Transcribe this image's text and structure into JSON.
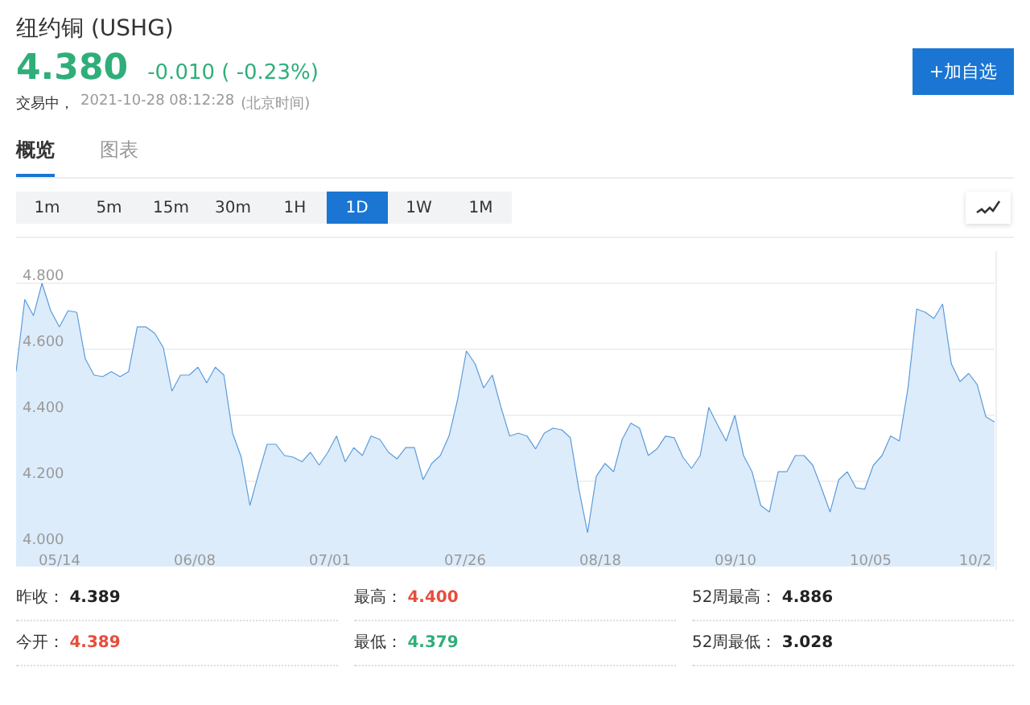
{
  "header": {
    "title": "纽约铜 (USHG)",
    "price": "4.380",
    "change": "-0.010 ( -0.23%)",
    "status": "交易中，",
    "timestamp": "2021-10-28 08:12:28",
    "timezone": "(北京时间)",
    "watchlist_button": "+加自选"
  },
  "tabs": [
    {
      "label": "概览",
      "selected": true
    },
    {
      "label": "图表",
      "selected": false
    }
  ],
  "periods": [
    {
      "label": "1m",
      "selected": false
    },
    {
      "label": "5m",
      "selected": false
    },
    {
      "label": "15m",
      "selected": false
    },
    {
      "label": "30m",
      "selected": false
    },
    {
      "label": "1H",
      "selected": false
    },
    {
      "label": "1D",
      "selected": true
    },
    {
      "label": "1W",
      "selected": false
    },
    {
      "label": "1M",
      "selected": false
    }
  ],
  "chart_data": {
    "type": "area",
    "grid": true,
    "series": [
      {
        "color": "#5b9bdc",
        "values": [
          4.532,
          4.751,
          4.702,
          4.8,
          4.717,
          4.668,
          4.717,
          4.712,
          4.571,
          4.522,
          4.517,
          4.532,
          4.517,
          4.532,
          4.668,
          4.668,
          4.649,
          4.605,
          4.473,
          4.522,
          4.522,
          4.546,
          4.498,
          4.546,
          4.522,
          4.346,
          4.273,
          4.127,
          4.224,
          4.312,
          4.312,
          4.278,
          4.273,
          4.259,
          4.288,
          4.249,
          4.288,
          4.337,
          4.259,
          4.302,
          4.278,
          4.337,
          4.327,
          4.288,
          4.268,
          4.302,
          4.302,
          4.205,
          4.254,
          4.278,
          4.337,
          4.449,
          4.595,
          4.556,
          4.483,
          4.522,
          4.424,
          4.337,
          4.346,
          4.337,
          4.298,
          4.346,
          4.361,
          4.356,
          4.332,
          4.176,
          4.044,
          4.215,
          4.254,
          4.229,
          4.327,
          4.376,
          4.361,
          4.278,
          4.298,
          4.337,
          4.332,
          4.273,
          4.239,
          4.278,
          4.424,
          4.371,
          4.322,
          4.4,
          4.278,
          4.229,
          4.127,
          4.107,
          4.229,
          4.229,
          4.278,
          4.278,
          4.249,
          4.18,
          4.107,
          4.205,
          4.229,
          4.18,
          4.176,
          4.249,
          4.278,
          4.337,
          4.322,
          4.483,
          4.722,
          4.712,
          4.693,
          4.737,
          4.556,
          4.502,
          4.527,
          4.493,
          4.395,
          4.38
        ]
      }
    ],
    "ylim": [
      4.0,
      4.8
    ],
    "yticks": [
      {
        "value": 4.8,
        "label": "4.800"
      },
      {
        "value": 4.6,
        "label": "4.600"
      },
      {
        "value": 4.4,
        "label": "4.400"
      },
      {
        "value": 4.2,
        "label": "4.200"
      },
      {
        "value": 4.0,
        "label": "4.000"
      }
    ]
  },
  "x_axis_labels": [
    "05/14",
    "06/08",
    "07/01",
    "07/26",
    "08/18",
    "09/10",
    "10/05",
    "10/2"
  ],
  "stats": [
    {
      "label": "昨收：",
      "value": "4.389",
      "color": "#222222"
    },
    {
      "label": "最高：",
      "value": "4.400",
      "color": "#e84c3d"
    },
    {
      "label": "52周最高：",
      "value": "4.886",
      "color": "#222222"
    },
    {
      "label": "今开：",
      "value": "4.389",
      "color": "#e84c3d"
    },
    {
      "label": "最低：",
      "value": "4.379",
      "color": "#2fae7a"
    },
    {
      "label": "52周最低：",
      "value": "3.028",
      "color": "#222222"
    }
  ]
}
